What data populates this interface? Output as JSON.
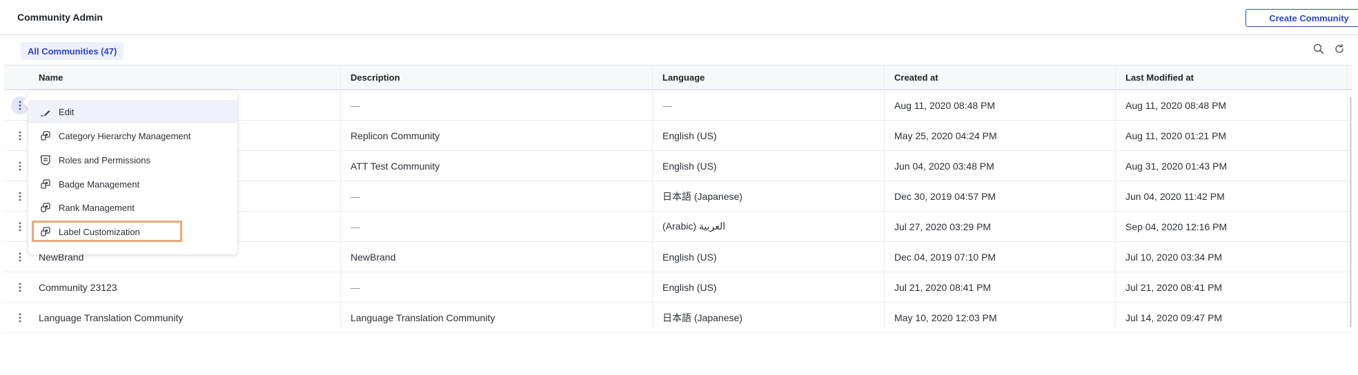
{
  "header": {
    "title": "Community Admin",
    "create_button": "Create Community"
  },
  "filter": {
    "active_tab": "All Communities (47)"
  },
  "toolbar": {
    "search_icon": "search-icon",
    "refresh_icon": "refresh-icon"
  },
  "table": {
    "columns": [
      "Name",
      "Description",
      "Language",
      "Created at",
      "Last Modified at"
    ],
    "rows": [
      {
        "name": "",
        "description": "—",
        "language": "—",
        "created": "Aug 11, 2020 08:48 PM",
        "modified": "Aug 11, 2020 08:48 PM"
      },
      {
        "name": "",
        "description": "Replicon Community",
        "language": "English (US)",
        "created": "May 25, 2020 04:24 PM",
        "modified": "Aug 11, 2020 01:21 PM"
      },
      {
        "name": "",
        "description": "ATT Test Community",
        "language": "English (US)",
        "created": "Jun 04, 2020 03:48 PM",
        "modified": "Aug 31, 2020 01:43 PM"
      },
      {
        "name": "",
        "description": "—",
        "language": "日本語 (Japanese)",
        "created": "Dec 30, 2019 04:57 PM",
        "modified": "Jun 04, 2020 11:42 PM"
      },
      {
        "name": "",
        "description": "—",
        "language": "(Arabic) العربية",
        "created": "Jul 27, 2020 03:29 PM",
        "modified": "Sep 04, 2020 12:16 PM"
      },
      {
        "name": "NewBrand",
        "description": "NewBrand",
        "language": "English (US)",
        "created": "Dec 04, 2019 07:10 PM",
        "modified": "Jul 10, 2020 03:34 PM"
      },
      {
        "name": "Community 23123",
        "description": "—",
        "language": "English (US)",
        "created": "Jul 21, 2020 08:41 PM",
        "modified": "Jul 21, 2020 08:41 PM"
      },
      {
        "name": "Language Translation Community",
        "description": "Language Translation Community",
        "language": "日本語 (Japanese)",
        "created": "May 10, 2020 12:03 PM",
        "modified": "Jul 14, 2020 09:47 PM"
      }
    ]
  },
  "row_menu": {
    "items": [
      {
        "label": "Edit",
        "icon": "pencil-icon"
      },
      {
        "label": "Category Hierarchy Management",
        "icon": "module-icon"
      },
      {
        "label": "Roles and Permissions",
        "icon": "roles-icon"
      },
      {
        "label": "Badge Management",
        "icon": "module-icon"
      },
      {
        "label": "Rank Management",
        "icon": "module-icon"
      },
      {
        "label": "Label Customization",
        "icon": "module-icon"
      }
    ],
    "highlighted_item": "Label Customization"
  },
  "colors": {
    "accent": "#2f46c4",
    "highlight": "#e8a877"
  }
}
